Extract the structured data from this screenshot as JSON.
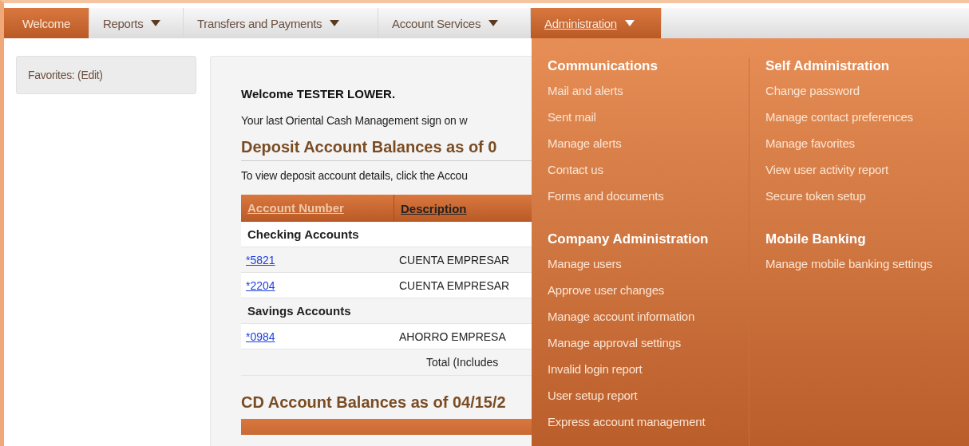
{
  "nav": {
    "tabs": [
      {
        "label": "Welcome",
        "has_menu": false,
        "selected": true,
        "open": false
      },
      {
        "label": "Reports",
        "has_menu": true,
        "selected": false,
        "open": false
      },
      {
        "label": "Transfers and Payments",
        "has_menu": true,
        "selected": false,
        "open": false
      },
      {
        "label": "Account Services",
        "has_menu": true,
        "selected": false,
        "open": false
      },
      {
        "label": "Administration",
        "has_menu": true,
        "selected": false,
        "open": true
      }
    ]
  },
  "sidebar": {
    "favorites": "Favorites: (Edit)"
  },
  "main": {
    "welcome": "Welcome TESTER LOWER.",
    "last_sign_on": "Your last Oriental Cash Management sign on w",
    "deposit_heading": "Deposit Account Balances as of 0",
    "deposit_hint": "To view deposit account details, click the Accou",
    "table": {
      "columns": [
        "Account Number",
        "Description"
      ],
      "rows": [
        {
          "kind": "group",
          "label": "Checking Accounts"
        },
        {
          "kind": "account",
          "number": "*5821",
          "description": "CUENTA EMPRESAR"
        },
        {
          "kind": "account",
          "number": "*2204",
          "description": "CUENTA EMPRESAR"
        },
        {
          "kind": "group",
          "label": "Savings Accounts"
        },
        {
          "kind": "account",
          "number": "*0984",
          "description": "AHORRO EMPRESA"
        },
        {
          "kind": "total",
          "description": "Total (Includes"
        }
      ]
    },
    "cd_heading": "CD Account Balances as of 04/15/2"
  },
  "menu": {
    "columns": [
      {
        "sections": [
          {
            "heading": "Communications",
            "items": [
              "Mail and alerts",
              "Sent mail",
              "Manage alerts",
              "Contact us",
              "Forms and documents"
            ]
          },
          {
            "heading": "Company Administration",
            "items": [
              "Manage users",
              "Approve user changes",
              "Manage account information",
              "Manage approval settings",
              "Invalid login report",
              "User setup report",
              "Express account management"
            ]
          }
        ]
      },
      {
        "sections": [
          {
            "heading": "Self Administration",
            "items": [
              "Change password",
              "Manage contact preferences",
              "Manage favorites",
              "View user activity report",
              "Secure token setup"
            ]
          },
          {
            "heading": "Mobile Banking",
            "items": [
              "Manage mobile banking settings"
            ]
          }
        ]
      }
    ]
  }
}
